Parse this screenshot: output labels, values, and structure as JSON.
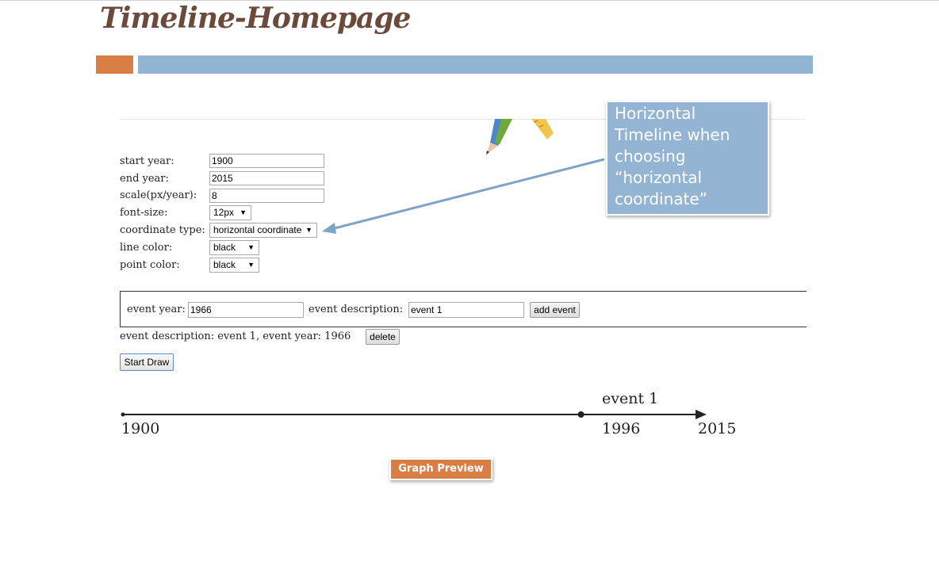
{
  "slide": {
    "title": "Timeline-Homepage"
  },
  "form": {
    "start_year_label": "start year:",
    "start_year_value": "1900",
    "end_year_label": "end year:",
    "end_year_value": "2015",
    "scale_label": "scale(px/year):",
    "scale_value": "8",
    "font_size_label": "font-size:",
    "font_size_value": "12px",
    "coord_type_label": "coordinate type:",
    "coord_type_value": "horizontal coordinate",
    "line_color_label": "line color:",
    "line_color_value": "black",
    "point_color_label": "point color:",
    "point_color_value": "black"
  },
  "event_form": {
    "year_label": "event year:",
    "year_value": "1966",
    "desc_label": "event description:",
    "desc_value": "event 1",
    "add_button": "add event"
  },
  "event_list": {
    "item_text": "event description: event 1, event year: 1966",
    "delete_button": "delete"
  },
  "start_draw_button": "Start Draw",
  "timeline": {
    "start_label": "1900",
    "event_year_label": "1996",
    "end_label": "2015",
    "event_name": "event 1",
    "event_position_fraction": 0.8
  },
  "callout": {
    "lines": [
      "Horizontal",
      "Timeline when",
      "choosing",
      "“horizontal",
      "coordinate”"
    ]
  },
  "graph_preview_button": "Graph Preview",
  "icons": {
    "decor": "pencil-ruler-icon"
  },
  "colors": {
    "accent_orange": "#d97e45",
    "accent_blue": "#94b4d3",
    "title_brown": "#6b4a3c"
  }
}
